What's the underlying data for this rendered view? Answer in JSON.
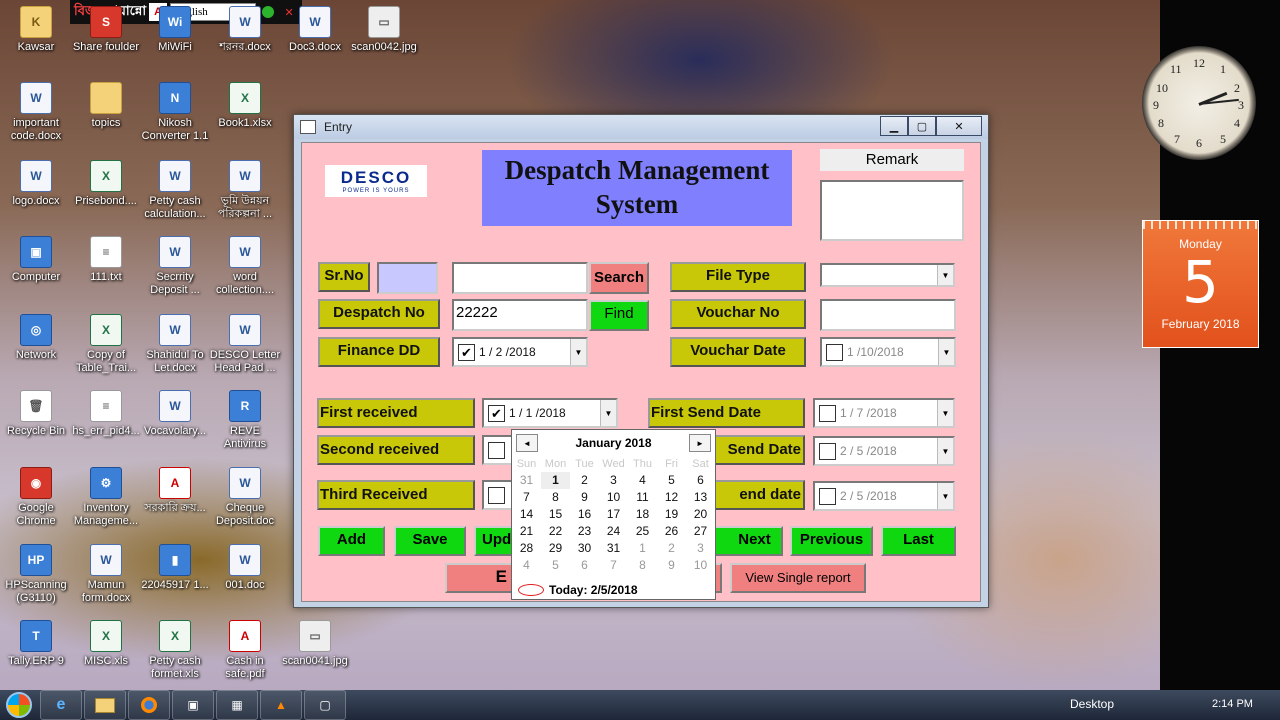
{
  "topbar": {
    "brand_red": "বিজয়",
    "brand_white": "বায়ান্নো",
    "language": "English"
  },
  "desktop_icons": [
    {
      "label": "Kawsar",
      "type": "folder",
      "glyph": "K"
    },
    {
      "label": "Share foulder",
      "type": "red",
      "glyph": "S"
    },
    {
      "label": "MiWiFi",
      "type": "app",
      "glyph": "Wi"
    },
    {
      "label": "শরনর.docx",
      "type": "doc",
      "glyph": "W"
    },
    {
      "label": "Doc3.docx",
      "type": "doc",
      "glyph": "W"
    },
    {
      "label": "scan0042.jpg",
      "type": "img",
      "glyph": "▭"
    },
    {
      "label": "important code.docx",
      "type": "doc",
      "glyph": "W"
    },
    {
      "label": "topics",
      "type": "folder",
      "glyph": ""
    },
    {
      "label": "Nikosh Converter 1.1",
      "type": "app",
      "glyph": "N"
    },
    {
      "label": "Book1.xlsx",
      "type": "xls",
      "glyph": "X"
    },
    {
      "label": "logo.docx",
      "type": "doc",
      "glyph": "W"
    },
    {
      "label": "Prisebond....",
      "type": "xls",
      "glyph": "X"
    },
    {
      "label": "Petty cash calculation...",
      "type": "doc",
      "glyph": "W"
    },
    {
      "label": "ভূমি উন্নয়ন পরিকল্পনা ...",
      "type": "doc",
      "glyph": "W"
    },
    {
      "label": "Computer",
      "type": "app",
      "glyph": "▣"
    },
    {
      "label": "111.txt",
      "type": "txt",
      "glyph": "≡"
    },
    {
      "label": "Secrrity Deposit ...",
      "type": "doc",
      "glyph": "W"
    },
    {
      "label": "word collection....",
      "type": "doc",
      "glyph": "W"
    },
    {
      "label": "Network",
      "type": "app",
      "glyph": "◎"
    },
    {
      "label": "Copy of Table_Trai...",
      "type": "xls",
      "glyph": "X"
    },
    {
      "label": "Shahidul To Let.docx",
      "type": "doc",
      "glyph": "W"
    },
    {
      "label": "DESCO Letter Head Pad ...",
      "type": "doc",
      "glyph": "W"
    },
    {
      "label": "Recycle Bin",
      "type": "txt",
      "glyph": "🗑"
    },
    {
      "label": "hs_err_pid4...",
      "type": "txt",
      "glyph": "≡"
    },
    {
      "label": "Vocavolary...",
      "type": "doc",
      "glyph": "W"
    },
    {
      "label": "REVE Antivirus",
      "type": "app",
      "glyph": "R"
    },
    {
      "label": "Google Chrome",
      "type": "red",
      "glyph": "◉"
    },
    {
      "label": "Inventory Manageme...",
      "type": "app",
      "glyph": "⚙"
    },
    {
      "label": "সরকারি ক্রয়...",
      "type": "pdf",
      "glyph": "A"
    },
    {
      "label": "Cheque Deposit.doc",
      "type": "doc",
      "glyph": "W"
    },
    {
      "label": "HPScanning (G3110)",
      "type": "app",
      "glyph": "HP"
    },
    {
      "label": "Mamun form.docx",
      "type": "doc",
      "glyph": "W"
    },
    {
      "label": "22045917 1...",
      "type": "app",
      "glyph": "▮"
    },
    {
      "label": "001.doc",
      "type": "doc",
      "glyph": "W"
    },
    {
      "label": "Tally.ERP 9",
      "type": "app",
      "glyph": "T"
    },
    {
      "label": "MISC.xls",
      "type": "xls",
      "glyph": "X"
    },
    {
      "label": "Petty cash formet.xls",
      "type": "xls",
      "glyph": "X"
    },
    {
      "label": "Cash in safe.pdf",
      "type": "pdf",
      "glyph": "A"
    },
    {
      "label": "scan0041.jpg",
      "type": "img",
      "glyph": "▭"
    }
  ],
  "calendar_gadget": {
    "day_name": "Monday",
    "day": "5",
    "month_year": "February 2018"
  },
  "window": {
    "title": "Entry",
    "logo_text": "DESCO",
    "logo_tagline": "POWER IS YOURS",
    "heading_line1": "Despatch Management",
    "heading_line2": "System",
    "remark_label": "Remark",
    "labels": {
      "sr_no": "Sr.No",
      "despatch_no": "Despatch No",
      "finance_dd": "Finance DD",
      "file_type": "File Type",
      "vouchar_no": "Vouchar No",
      "vouchar_date": "Vouchar Date",
      "first_received": "First received",
      "second_received": "Second received",
      "third_received": "Third Received",
      "first_send": "First Send Date",
      "second_send_partial": "Send Date",
      "third_send_partial": "end date"
    },
    "buttons": {
      "search": "Search",
      "find": "Find",
      "add": "Add",
      "save": "Save",
      "update_partial": "Upd",
      "next": "Next",
      "previous": "Previous",
      "last": "Last",
      "exit_partial": "E",
      "view_single": "View Single report"
    },
    "values": {
      "despatch_no": "22222",
      "finance_dd": "1 / 2 /2018",
      "vouchar_date": "1 /10/2018",
      "first_received": "1 / 1 /2018",
      "first_send": "1 / 7 /2018",
      "second_send": "2 / 5 /2018",
      "third_send": "2 / 5 /2018"
    },
    "calendar_popup": {
      "month": "January 2018",
      "dow": [
        "Sun",
        "Mon",
        "Tue",
        "Wed",
        "Thu",
        "Fri",
        "Sat"
      ],
      "weeks": [
        [
          "31",
          "1",
          "2",
          "3",
          "4",
          "5",
          "6"
        ],
        [
          "7",
          "8",
          "9",
          "10",
          "11",
          "12",
          "13"
        ],
        [
          "14",
          "15",
          "16",
          "17",
          "18",
          "19",
          "20"
        ],
        [
          "21",
          "22",
          "23",
          "24",
          "25",
          "26",
          "27"
        ],
        [
          "28",
          "29",
          "30",
          "31",
          "1",
          "2",
          "3"
        ],
        [
          "4",
          "5",
          "6",
          "7",
          "8",
          "9",
          "10"
        ]
      ],
      "today": "Today: 2/5/2018"
    }
  },
  "taskbar": {
    "desktop_label": "Desktop",
    "time": "2:14 PM"
  }
}
